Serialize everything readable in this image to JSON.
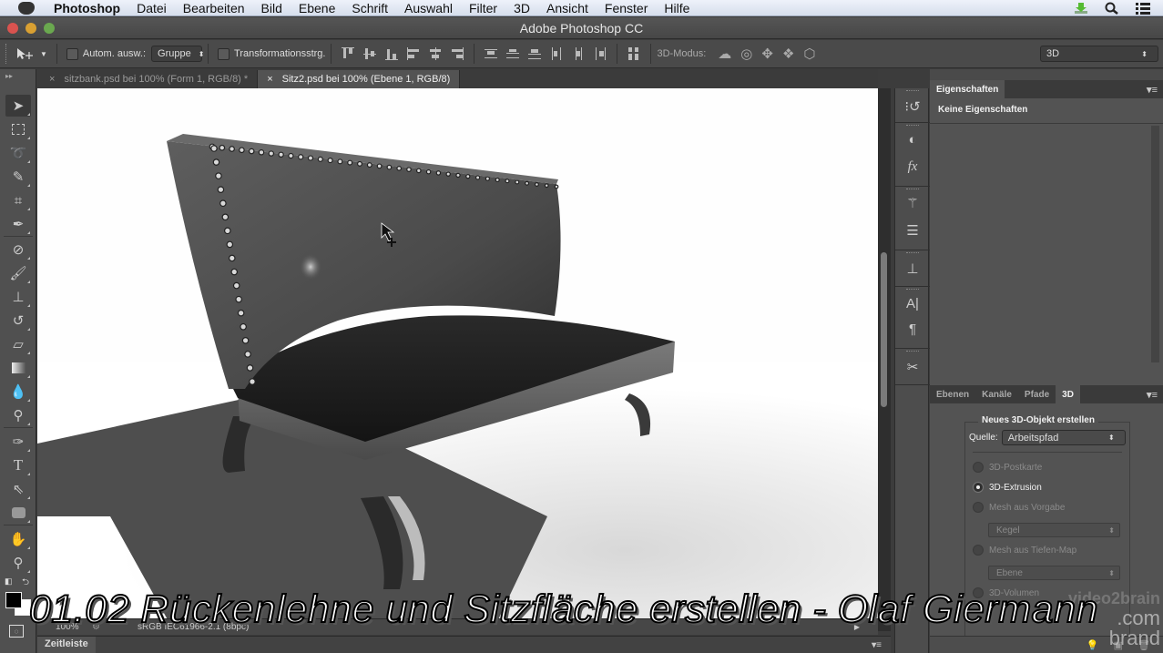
{
  "menubar": {
    "app": "Photoshop",
    "items": [
      "Datei",
      "Bearbeiten",
      "Bild",
      "Ebene",
      "Schrift",
      "Auswahl",
      "Filter",
      "3D",
      "Ansicht",
      "Fenster",
      "Hilfe"
    ],
    "right_icons": [
      "download-icon",
      "spotlight-search-icon",
      "notification-list-icon"
    ]
  },
  "window": {
    "title": "Adobe Photoshop CC"
  },
  "options_bar": {
    "tool_icon": "move-tool-icon",
    "auto_select_label": "Autom. ausw.:",
    "auto_select_checked": false,
    "auto_select_value": "Gruppe",
    "transform_label": "Transformationsstrg.",
    "transform_checked": false,
    "mode_label": "3D-Modus:",
    "workspace_value": "3D"
  },
  "document_tabs": [
    {
      "label": "sitzbank.psd bei 100% (Form 1, RGB/8) *",
      "active": false
    },
    {
      "label": "Sitz2.psd bei 100% (Ebene 1, RGB/8)",
      "active": true
    }
  ],
  "toolbox": {
    "tools": [
      "move-tool",
      "rectangular-marquee-tool",
      "lasso-tool",
      "quick-selection-tool",
      "crop-tool",
      "eyedropper-tool",
      "spot-healing-brush-tool",
      "brush-tool",
      "clone-stamp-tool",
      "history-brush-tool",
      "eraser-tool",
      "gradient-tool",
      "blur-tool",
      "dodge-tool",
      "pen-tool",
      "type-tool",
      "path-selection-tool",
      "rounded-rectangle-tool",
      "hand-tool",
      "zoom-tool"
    ],
    "foreground_color": "#000000",
    "background_color": "#ffffff"
  },
  "status_bar": {
    "zoom": "100%",
    "profile": "sRGB IEC61966-2.1 (8bpc)"
  },
  "timeline": {
    "tab": "Zeitleiste"
  },
  "properties_panel": {
    "tab": "Eigenschaften",
    "content": "Keine Eigenschaften"
  },
  "layers_panel": {
    "tabs": [
      "Ebenen",
      "Kanäle",
      "Pfade",
      "3D"
    ],
    "active_tab": "3D",
    "group_title": "Neues 3D-Objekt erstellen",
    "source_label": "Quelle:",
    "source_value": "Arbeitspfad",
    "options": [
      {
        "label": "3D-Postkarte",
        "selected": false,
        "enabled": false
      },
      {
        "label": "3D-Extrusion",
        "selected": true,
        "enabled": true
      },
      {
        "label": "Mesh aus Vorgabe",
        "selected": false,
        "enabled": false
      },
      {
        "label": "Mesh aus Tiefen-Map",
        "selected": false,
        "enabled": false
      },
      {
        "label": "3D-Volumen",
        "selected": false,
        "enabled": false
      }
    ],
    "preset_value": "Kegel",
    "depthmap_value": "Ebene"
  },
  "overlay": {
    "caption": "01.02 Rückenlehne und Sitzfläche erstellen - Olaf Giermann",
    "watermark_line1": "video2brain",
    "watermark_line2": ".com",
    "watermark_line3": "brand"
  }
}
